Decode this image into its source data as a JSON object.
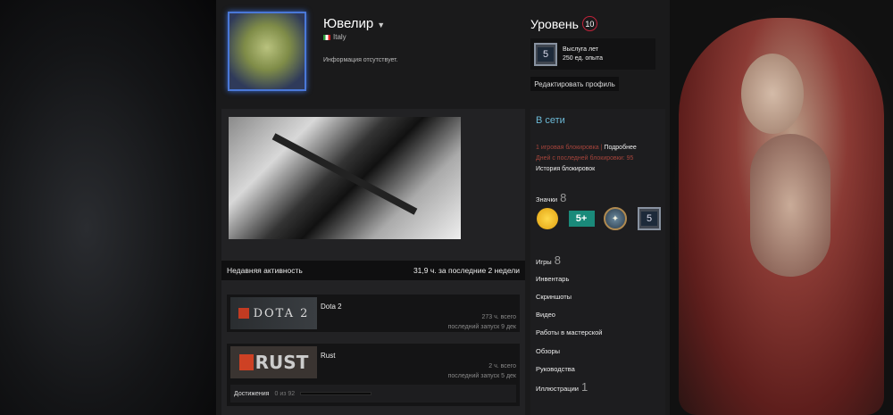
{
  "profile": {
    "name": "Ювелир",
    "country": "Italy",
    "summary": "Информация отсутствует."
  },
  "level": {
    "label": "Уровень",
    "value": "10",
    "badge_value": "5",
    "badge_title": "Выслуга лет",
    "badge_xp": "250 ед. опыта",
    "edit_button": "Редактировать профиль"
  },
  "activity": {
    "title": "Недавняя активность",
    "hours": "31,9 ч. за последние 2 недели",
    "games": [
      {
        "name": "Dota 2",
        "logo": "DOTA 2",
        "total": "273 ч. всего",
        "last": "последний запуск 9 дек"
      },
      {
        "name": "Rust",
        "logo": "RUST",
        "total": "2 ч. всего",
        "last": "последний запуск 5 дек",
        "achievements_label": "Достижения",
        "achievements_value": "0 из 92",
        "achievements_progress": 0
      }
    ]
  },
  "sidebar": {
    "status": "В сети",
    "ban_count": "1 игровая блокировка",
    "ban_sep": " | ",
    "ban_details": "Подробнее",
    "ban_days": "Дней с последней блокировки: 95",
    "ban_history": "История блокировок",
    "badges_label": "Значки",
    "badges_count": "8",
    "badge_years": "5+",
    "badge_level": "5",
    "links": [
      {
        "label": "Игры",
        "count": "8"
      },
      {
        "label": "Инвентарь"
      },
      {
        "label": "Скриншоты"
      },
      {
        "label": "Видео"
      },
      {
        "label": "Работы в мастерской"
      },
      {
        "label": "Обзоры"
      },
      {
        "label": "Руководства"
      },
      {
        "label": "Иллюстрации",
        "count": "1"
      }
    ]
  },
  "colors": {
    "accent_online": "#6cb9d6",
    "ban_red": "#a5443b",
    "level_ring": "#c0223a"
  }
}
